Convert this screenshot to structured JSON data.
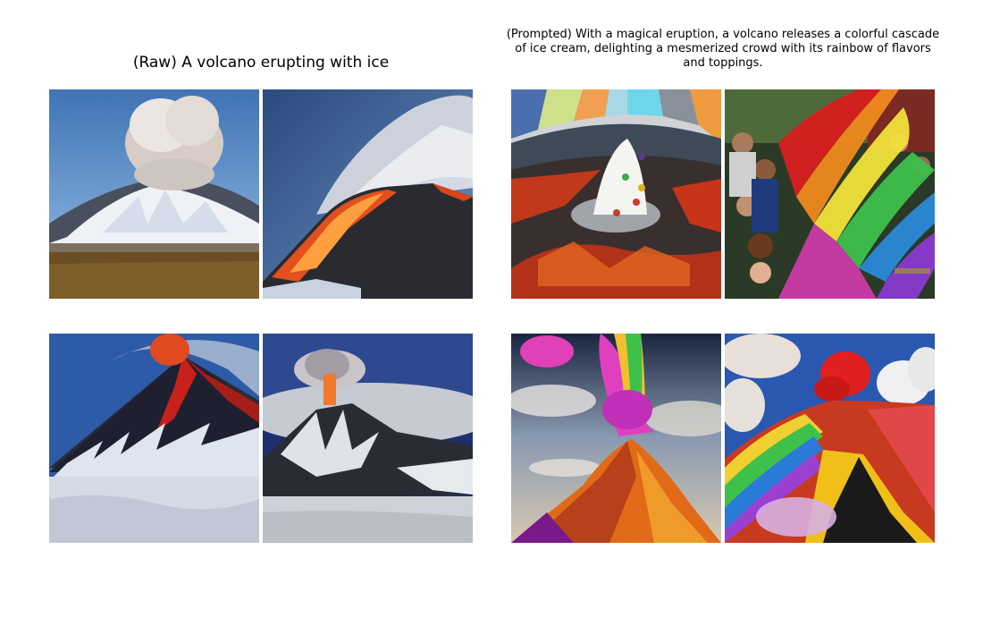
{
  "figure": {
    "left_panel": {
      "title": "(Raw) A volcano erupting with ice",
      "images": [
        {
          "subject": "snow-capped volcano with grey ash plume over dry grassland"
        },
        {
          "subject": "dark volcano with glowing lava flow and white steam plume"
        },
        {
          "subject": "snowy volcano with red lava at summit"
        },
        {
          "subject": "icy volcano with distant ash plume over snow field"
        }
      ]
    },
    "right_panel": {
      "title": "(Prompted) With a magical eruption, a volcano releases a colorful cascade of ice cream, delighting a mesmerized crowd with its rainbow of flavors and toppings.",
      "images": [
        {
          "subject": "white ice-cream cone volcano with candy dots in lava crater, colorful sky rays"
        },
        {
          "subject": "rainbow cascade with a crowd of people"
        },
        {
          "subject": "orange volcano with rainbow plume"
        },
        {
          "subject": "red and rainbow volcano with white clouds"
        }
      ]
    }
  }
}
